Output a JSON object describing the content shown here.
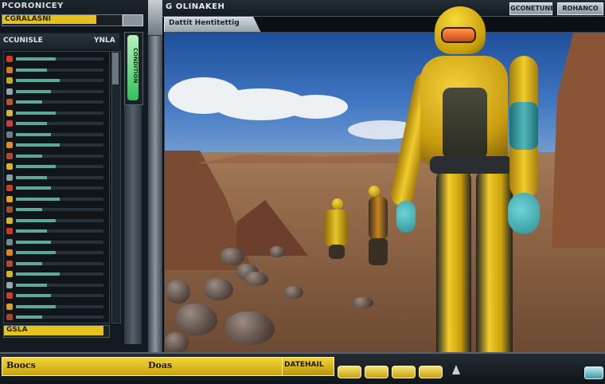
{
  "top_left": {
    "title": "PCORONICEY",
    "meter_label": "CGRALASNI",
    "meter_fill": 0.8
  },
  "window": {
    "title": "G OLINAKEH",
    "btn1": "GCONETUNE",
    "btn2": "ROHANCO",
    "subtab": "Dattit Hentitettig"
  },
  "list": {
    "header_left": "CCUNISLE",
    "header_right": "YNLA",
    "rows": [
      {
        "color": "#d33a2a",
        "fill": 0.45
      },
      {
        "color": "#e0722a",
        "fill": 0.35
      },
      {
        "color": "#c9a52a",
        "fill": 0.5
      },
      {
        "color": "#8fa6b0",
        "fill": 0.4
      },
      {
        "color": "#c2502a",
        "fill": 0.3
      },
      {
        "color": "#d9b23a",
        "fill": 0.45
      },
      {
        "color": "#cf3a3a",
        "fill": 0.35
      },
      {
        "color": "#6e7f88",
        "fill": 0.4
      },
      {
        "color": "#e08a2a",
        "fill": 0.5
      },
      {
        "color": "#b8462a",
        "fill": 0.3
      },
      {
        "color": "#d8b02a",
        "fill": 0.45
      },
      {
        "color": "#8d9aa2",
        "fill": 0.35
      },
      {
        "color": "#c9402a",
        "fill": 0.4
      },
      {
        "color": "#e4a02a",
        "fill": 0.5
      },
      {
        "color": "#a34a2a",
        "fill": 0.3
      },
      {
        "color": "#d2b43a",
        "fill": 0.45
      },
      {
        "color": "#c63a2a",
        "fill": 0.35
      },
      {
        "color": "#7b8a92",
        "fill": 0.4
      },
      {
        "color": "#e0822a",
        "fill": 0.45
      },
      {
        "color": "#b44a2a",
        "fill": 0.3
      },
      {
        "color": "#d7b02a",
        "fill": 0.5
      },
      {
        "color": "#9aa6ad",
        "fill": 0.35
      },
      {
        "color": "#cc3a2a",
        "fill": 0.4
      },
      {
        "color": "#e29a2a",
        "fill": 0.45
      },
      {
        "color": "#a8462a",
        "fill": 0.3
      }
    ],
    "bottom_label": "GSLA",
    "bottom_fill": 0.96
  },
  "gauge": {
    "label": "CONDITION",
    "fill": 1.0
  },
  "bottom": {
    "left_label": "Boocs",
    "center_label": "Doas",
    "right_label": "DATEHAIL"
  }
}
